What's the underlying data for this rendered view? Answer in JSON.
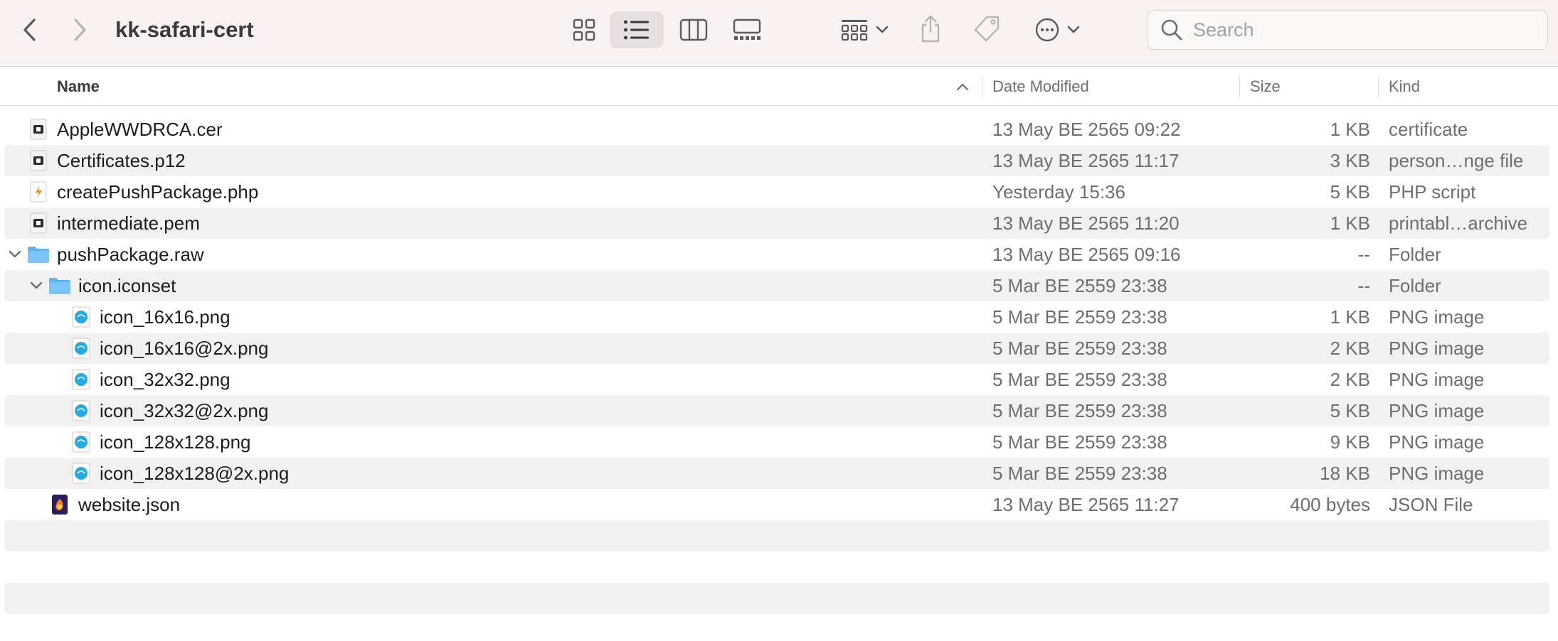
{
  "window": {
    "title": "kk-safari-cert"
  },
  "toolbar": {
    "back_icon": "chevron-left-icon",
    "forward_icon": "chevron-right-icon",
    "views": [
      "icon-view",
      "list-view",
      "column-view",
      "gallery-view"
    ],
    "active_view": "list-view",
    "group_icon": "group-by-icon",
    "share_icon": "share-icon",
    "tag_icon": "tag-icon",
    "more_icon": "ellipsis-circle-icon"
  },
  "search": {
    "placeholder": "Search",
    "value": ""
  },
  "columns": {
    "name": "Name",
    "date": "Date Modified",
    "size": "Size",
    "kind": "Kind",
    "sort": "ascending"
  },
  "files": [
    {
      "name": "AppleWWDRCA.cer",
      "date": "13 May BE 2565 09:22",
      "size": "1 KB",
      "kind": "certificate",
      "icon": "certificate-icon",
      "level": 0
    },
    {
      "name": "Certificates.p12",
      "date": "13 May BE 2565 11:17",
      "size": "3 KB",
      "kind": "person…nge file",
      "icon": "certificate-icon",
      "level": 0
    },
    {
      "name": "createPushPackage.php",
      "date": "Yesterday 15:36",
      "size": "5 KB",
      "kind": "PHP script",
      "icon": "php-file-icon",
      "level": 0
    },
    {
      "name": "intermediate.pem",
      "date": "13 May BE 2565 11:20",
      "size": "1 KB",
      "kind": "printabl…archive",
      "icon": "certificate-icon",
      "level": 0
    },
    {
      "name": "pushPackage.raw",
      "date": "13 May BE 2565 09:16",
      "size": "--",
      "kind": "Folder",
      "icon": "folder-icon",
      "level": 0,
      "expanded": true
    },
    {
      "name": "icon.iconset",
      "date": "5 Mar BE 2559 23:38",
      "size": "--",
      "kind": "Folder",
      "icon": "folder-icon",
      "level": 1,
      "expanded": true
    },
    {
      "name": "icon_16x16.png",
      "date": "5 Mar BE 2559 23:38",
      "size": "1 KB",
      "kind": "PNG image",
      "icon": "png-image-icon",
      "level": 2
    },
    {
      "name": "icon_16x16@2x.png",
      "date": "5 Mar BE 2559 23:38",
      "size": "2 KB",
      "kind": "PNG image",
      "icon": "png-image-icon",
      "level": 2
    },
    {
      "name": "icon_32x32.png",
      "date": "5 Mar BE 2559 23:38",
      "size": "2 KB",
      "kind": "PNG image",
      "icon": "png-image-icon",
      "level": 2
    },
    {
      "name": "icon_32x32@2x.png",
      "date": "5 Mar BE 2559 23:38",
      "size": "5 KB",
      "kind": "PNG image",
      "icon": "png-image-icon",
      "level": 2
    },
    {
      "name": "icon_128x128.png",
      "date": "5 Mar BE 2559 23:38",
      "size": "9 KB",
      "kind": "PNG image",
      "icon": "png-image-icon",
      "level": 2
    },
    {
      "name": "icon_128x128@2x.png",
      "date": "5 Mar BE 2559 23:38",
      "size": "18 KB",
      "kind": "PNG image",
      "icon": "png-image-icon",
      "level": 2
    },
    {
      "name": "website.json",
      "date": "13 May BE 2565 11:27",
      "size": "400 bytes",
      "kind": "JSON File",
      "icon": "json-file-icon",
      "level": 1
    }
  ],
  "colors": {
    "toolbar_bg": "#f8f2f2",
    "stripe": "#f1f1f1",
    "folder": "#5fb3f0",
    "png_icon": "#29a9e0"
  }
}
